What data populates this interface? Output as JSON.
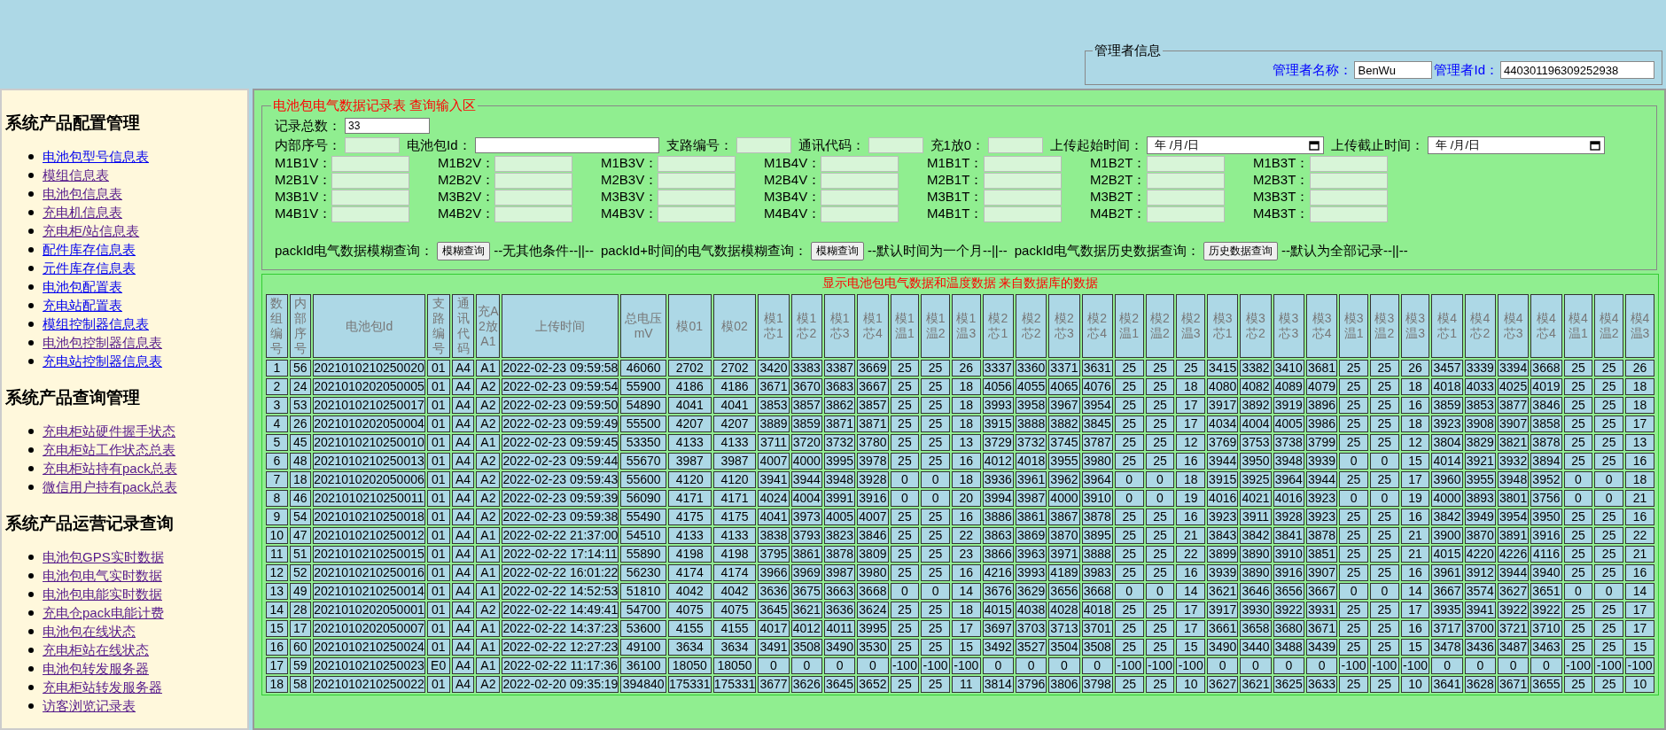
{
  "admin": {
    "legend": "管理者信息",
    "name_label": "管理者名称：",
    "name_value": "BenWu",
    "id_label": "管理者Id：",
    "id_value": "440301196309252938"
  },
  "sidebar": {
    "sections": [
      {
        "title": "系统产品配置管理",
        "links": [
          {
            "label": "电池包型号信息表",
            "visited": false
          },
          {
            "label": "模组信息表",
            "visited": true
          },
          {
            "label": "电池包信息表",
            "visited": true
          },
          {
            "label": "充电机信息表",
            "visited": true
          },
          {
            "label": "充电柜/站信息表",
            "visited": true
          },
          {
            "label": "配件库存信息表",
            "visited": false
          },
          {
            "label": "元件库存信息表",
            "visited": false
          },
          {
            "label": "电池包配置表",
            "visited": false
          },
          {
            "label": "充电站配置表",
            "visited": false
          },
          {
            "label": "模组控制器信息表",
            "visited": false
          },
          {
            "label": "电池包控制器信息表",
            "visited": true
          },
          {
            "label": "充电站控制器信息表",
            "visited": false
          }
        ]
      },
      {
        "title": "系统产品查询管理",
        "links": [
          {
            "label": "充电柜站硬件握手状态",
            "visited": true
          },
          {
            "label": "充电柜站工作状态总表",
            "visited": true
          },
          {
            "label": "充电柜站持有pack总表",
            "visited": true
          },
          {
            "label": "微信用户持有pack总表",
            "visited": true
          }
        ]
      },
      {
        "title": "系统产品运营记录查询",
        "links": [
          {
            "label": "电池包GPS实时数据",
            "visited": true
          },
          {
            "label": "电池包电气实时数据",
            "visited": true
          },
          {
            "label": "电池包电能实时数据",
            "visited": true
          },
          {
            "label": "充电仓pack电能计费",
            "visited": true
          },
          {
            "label": "电池包在线状态",
            "visited": true
          },
          {
            "label": "充电柜站在线状态",
            "visited": true
          },
          {
            "label": "电池包转发服务器",
            "visited": true
          },
          {
            "label": "充电柜站转发服务器",
            "visited": true
          },
          {
            "label": "访客浏览记录表",
            "visited": true
          }
        ]
      }
    ]
  },
  "query": {
    "legend": "电池包电气数据记录表 查询输入区",
    "record_total": {
      "label": "记录总数：",
      "value": "33"
    },
    "filters": [
      {
        "kind": "text",
        "label": "内部序号："
      },
      {
        "kind": "wide",
        "label": "电池包Id："
      },
      {
        "kind": "text",
        "label": "支路编号："
      },
      {
        "kind": "text",
        "label": "通讯代码："
      },
      {
        "kind": "text",
        "label": "充1放0："
      },
      {
        "kind": "date",
        "label": "上传起始时间：",
        "placeholder": "年 /月/日"
      },
      {
        "kind": "date",
        "label": "上传截止时间：",
        "placeholder": "年 /月/日"
      }
    ],
    "module_fields": [
      [
        "M1B1V：",
        "M1B2V：",
        "M1B3V：",
        "M1B4V：",
        "M1B1T：",
        "M1B2T：",
        "M1B3T："
      ],
      [
        "M2B1V：",
        "M2B2V：",
        "M2B3V：",
        "M2B4V：",
        "M2B1T：",
        "M2B2T：",
        "M2B3T："
      ],
      [
        "M3B1V：",
        "M3B2V：",
        "M3B3V：",
        "M3B4V：",
        "M3B1T：",
        "M3B2T：",
        "M3B3T："
      ],
      [
        "M4B1V：",
        "M4B2V：",
        "M4B3V：",
        "M4B4V：",
        "M4B1T：",
        "M4B2T：",
        "M4B3T："
      ]
    ],
    "actions": [
      {
        "label": "packId电气数据模糊查询：",
        "button": "模糊查询",
        "note": "--无其他条件--||--"
      },
      {
        "label": "packId+时间的电气数据模糊查询：",
        "button": "模糊查询",
        "note": "--默认时间为一个月--||--"
      },
      {
        "label": "packId电气数据历史数据查询：",
        "button": "历史数据查询",
        "note": "--默认为全部记录--||--"
      }
    ]
  },
  "table": {
    "caption": "显示电池包电气数据和温度数据 来自数据库的数据",
    "columns": [
      "数组编号",
      "内部序号",
      "电池包Id",
      "支路编号",
      "通讯代码",
      "充A2放A1",
      "上传时间",
      "总电压mV",
      "模01",
      "模02",
      "模1芯1",
      "模1芯2",
      "模1芯3",
      "模1芯4",
      "模1温1",
      "模1温2",
      "模1温3",
      "模2芯1",
      "模2芯2",
      "模2芯3",
      "模2芯4",
      "模2温1",
      "模2温2",
      "模2温3",
      "模3芯1",
      "模3芯2",
      "模3芯3",
      "模3芯4",
      "模3温1",
      "模3温2",
      "模3温3",
      "模4芯1",
      "模4芯2",
      "模4芯3",
      "模4芯4",
      "模4温1",
      "模4温2",
      "模4温3"
    ],
    "rows": [
      [
        "1",
        "56",
        "2021010210250020",
        "01",
        "A4",
        "A1",
        "2022-02-23 09:59:58",
        "46060",
        "2702",
        "2702",
        "3420",
        "3383",
        "3387",
        "3669",
        "25",
        "25",
        "26",
        "3337",
        "3360",
        "3371",
        "3631",
        "25",
        "25",
        "25",
        "3415",
        "3382",
        "3410",
        "3681",
        "25",
        "25",
        "26",
        "3457",
        "3339",
        "3394",
        "3668",
        "25",
        "25",
        "26"
      ],
      [
        "2",
        "24",
        "2021010202050005",
        "01",
        "A4",
        "A2",
        "2022-02-23 09:59:54",
        "55900",
        "4186",
        "4186",
        "3671",
        "3670",
        "3683",
        "3667",
        "25",
        "25",
        "18",
        "4056",
        "4055",
        "4065",
        "4076",
        "25",
        "25",
        "18",
        "4080",
        "4082",
        "4089",
        "4079",
        "25",
        "25",
        "18",
        "4018",
        "4033",
        "4025",
        "4019",
        "25",
        "25",
        "18"
      ],
      [
        "3",
        "53",
        "2021010210250017",
        "01",
        "A4",
        "A2",
        "2022-02-23 09:59:50",
        "54890",
        "4041",
        "4041",
        "3853",
        "3857",
        "3862",
        "3857",
        "25",
        "25",
        "18",
        "3993",
        "3958",
        "3967",
        "3954",
        "25",
        "25",
        "17",
        "3917",
        "3892",
        "3919",
        "3896",
        "25",
        "25",
        "16",
        "3859",
        "3853",
        "3877",
        "3846",
        "25",
        "25",
        "18"
      ],
      [
        "4",
        "26",
        "2021010202050004",
        "01",
        "A4",
        "A2",
        "2022-02-23 09:59:49",
        "55500",
        "4207",
        "4207",
        "3889",
        "3859",
        "3871",
        "3871",
        "25",
        "25",
        "18",
        "3915",
        "3888",
        "3882",
        "3845",
        "25",
        "25",
        "17",
        "4034",
        "4004",
        "4005",
        "3986",
        "25",
        "25",
        "18",
        "3923",
        "3908",
        "3907",
        "3858",
        "25",
        "25",
        "17"
      ],
      [
        "5",
        "45",
        "2021010210250010",
        "01",
        "A4",
        "A1",
        "2022-02-23 09:59:45",
        "53350",
        "4133",
        "4133",
        "3711",
        "3720",
        "3732",
        "3780",
        "25",
        "25",
        "13",
        "3729",
        "3732",
        "3745",
        "3787",
        "25",
        "25",
        "12",
        "3769",
        "3753",
        "3738",
        "3799",
        "25",
        "25",
        "12",
        "3804",
        "3829",
        "3821",
        "3878",
        "25",
        "25",
        "13"
      ],
      [
        "6",
        "48",
        "2021010210250013",
        "01",
        "A4",
        "A2",
        "2022-02-23 09:59:44",
        "55670",
        "3987",
        "3987",
        "4007",
        "4000",
        "3995",
        "3978",
        "25",
        "25",
        "16",
        "4012",
        "4018",
        "3955",
        "3980",
        "25",
        "25",
        "16",
        "3944",
        "3950",
        "3948",
        "3939",
        "0",
        "0",
        "15",
        "4014",
        "3921",
        "3932",
        "3894",
        "25",
        "25",
        "16"
      ],
      [
        "7",
        "18",
        "2021010202050006",
        "01",
        "A4",
        "A2",
        "2022-02-23 09:59:43",
        "55600",
        "4120",
        "4120",
        "3941",
        "3944",
        "3948",
        "3928",
        "0",
        "0",
        "18",
        "3936",
        "3961",
        "3962",
        "3964",
        "0",
        "0",
        "18",
        "3915",
        "3925",
        "3964",
        "3944",
        "25",
        "25",
        "17",
        "3960",
        "3955",
        "3948",
        "3952",
        "0",
        "0",
        "18"
      ],
      [
        "8",
        "46",
        "2021010210250011",
        "01",
        "A4",
        "A2",
        "2022-02-23 09:59:39",
        "56090",
        "4171",
        "4171",
        "4024",
        "4004",
        "3991",
        "3916",
        "0",
        "0",
        "20",
        "3994",
        "3987",
        "4000",
        "3910",
        "0",
        "0",
        "19",
        "4016",
        "4021",
        "4016",
        "3923",
        "0",
        "0",
        "19",
        "4000",
        "3893",
        "3801",
        "3756",
        "0",
        "0",
        "21"
      ],
      [
        "9",
        "54",
        "2021010210250018",
        "01",
        "A4",
        "A2",
        "2022-02-23 09:59:38",
        "55490",
        "4175",
        "4175",
        "4041",
        "3973",
        "4005",
        "4007",
        "25",
        "25",
        "16",
        "3886",
        "3861",
        "3867",
        "3878",
        "25",
        "25",
        "16",
        "3923",
        "3911",
        "3928",
        "3923",
        "25",
        "25",
        "16",
        "3842",
        "3949",
        "3954",
        "3950",
        "25",
        "25",
        "16"
      ],
      [
        "10",
        "47",
        "2021010210250012",
        "01",
        "A4",
        "A1",
        "2022-02-22 21:37:00",
        "54510",
        "4133",
        "4133",
        "3838",
        "3793",
        "3823",
        "3846",
        "25",
        "25",
        "22",
        "3863",
        "3869",
        "3870",
        "3895",
        "25",
        "25",
        "21",
        "3843",
        "3842",
        "3841",
        "3878",
        "25",
        "25",
        "21",
        "3900",
        "3870",
        "3891",
        "3916",
        "25",
        "25",
        "22"
      ],
      [
        "11",
        "51",
        "2021010210250015",
        "01",
        "A4",
        "A1",
        "2022-02-22 17:14:11",
        "55890",
        "4198",
        "4198",
        "3795",
        "3861",
        "3878",
        "3809",
        "25",
        "25",
        "23",
        "3866",
        "3963",
        "3971",
        "3888",
        "25",
        "25",
        "22",
        "3899",
        "3890",
        "3910",
        "3851",
        "25",
        "25",
        "21",
        "4015",
        "4220",
        "4226",
        "4116",
        "25",
        "25",
        "21"
      ],
      [
        "12",
        "52",
        "2021010210250016",
        "01",
        "A4",
        "A1",
        "2022-02-22 16:01:22",
        "56230",
        "4174",
        "4174",
        "3966",
        "3969",
        "3987",
        "3980",
        "25",
        "25",
        "16",
        "4216",
        "3993",
        "4189",
        "3983",
        "25",
        "25",
        "16",
        "3939",
        "3890",
        "3916",
        "3907",
        "25",
        "25",
        "16",
        "3961",
        "3912",
        "3944",
        "3940",
        "25",
        "25",
        "16"
      ],
      [
        "13",
        "49",
        "2021010210250014",
        "01",
        "A4",
        "A1",
        "2022-02-22 14:52:53",
        "51810",
        "4042",
        "4042",
        "3636",
        "3675",
        "3663",
        "3668",
        "0",
        "0",
        "14",
        "3676",
        "3629",
        "3656",
        "3668",
        "0",
        "0",
        "14",
        "3621",
        "3646",
        "3656",
        "3667",
        "0",
        "0",
        "14",
        "3667",
        "3574",
        "3627",
        "3651",
        "0",
        "0",
        "14"
      ],
      [
        "14",
        "28",
        "2021010202050001",
        "01",
        "A4",
        "A2",
        "2022-02-22 14:49:41",
        "54700",
        "4075",
        "4075",
        "3645",
        "3621",
        "3636",
        "3624",
        "25",
        "25",
        "18",
        "4015",
        "4038",
        "4028",
        "4018",
        "25",
        "25",
        "17",
        "3917",
        "3930",
        "3922",
        "3931",
        "25",
        "25",
        "17",
        "3935",
        "3941",
        "3922",
        "3922",
        "25",
        "25",
        "17"
      ],
      [
        "15",
        "17",
        "2021010202050007",
        "01",
        "A4",
        "A1",
        "2022-02-22 14:37:23",
        "53600",
        "4155",
        "4155",
        "4017",
        "4012",
        "4011",
        "3995",
        "25",
        "25",
        "17",
        "3697",
        "3703",
        "3713",
        "3701",
        "25",
        "25",
        "17",
        "3661",
        "3658",
        "3680",
        "3671",
        "25",
        "25",
        "16",
        "3717",
        "3700",
        "3721",
        "3710",
        "25",
        "25",
        "17"
      ],
      [
        "16",
        "60",
        "2021010210250024",
        "01",
        "A4",
        "A1",
        "2022-02-22 12:27:23",
        "49100",
        "3634",
        "3634",
        "3491",
        "3508",
        "3490",
        "3530",
        "25",
        "25",
        "15",
        "3492",
        "3527",
        "3504",
        "3508",
        "25",
        "25",
        "15",
        "3490",
        "3440",
        "3488",
        "3439",
        "25",
        "25",
        "15",
        "3478",
        "3436",
        "3487",
        "3463",
        "25",
        "25",
        "15"
      ],
      [
        "17",
        "59",
        "2021010210250023",
        "E0",
        "A4",
        "A1",
        "2022-02-22 11:17:36",
        "36100",
        "18050",
        "18050",
        "0",
        "0",
        "0",
        "0",
        "-100",
        "-100",
        "-100",
        "0",
        "0",
        "0",
        "0",
        "-100",
        "-100",
        "-100",
        "0",
        "0",
        "0",
        "0",
        "-100",
        "-100",
        "-100",
        "0",
        "0",
        "0",
        "0",
        "-100",
        "-100",
        "-100"
      ],
      [
        "18",
        "58",
        "2021010210250022",
        "01",
        "A4",
        "A2",
        "2022-02-20 09:35:19",
        "394840",
        "175331",
        "175331",
        "3677",
        "3626",
        "3645",
        "3652",
        "25",
        "25",
        "11",
        "3814",
        "3796",
        "3806",
        "3798",
        "25",
        "25",
        "10",
        "3627",
        "3621",
        "3625",
        "3633",
        "25",
        "25",
        "10",
        "3641",
        "3628",
        "3671",
        "3655",
        "25",
        "25",
        "10"
      ]
    ]
  }
}
